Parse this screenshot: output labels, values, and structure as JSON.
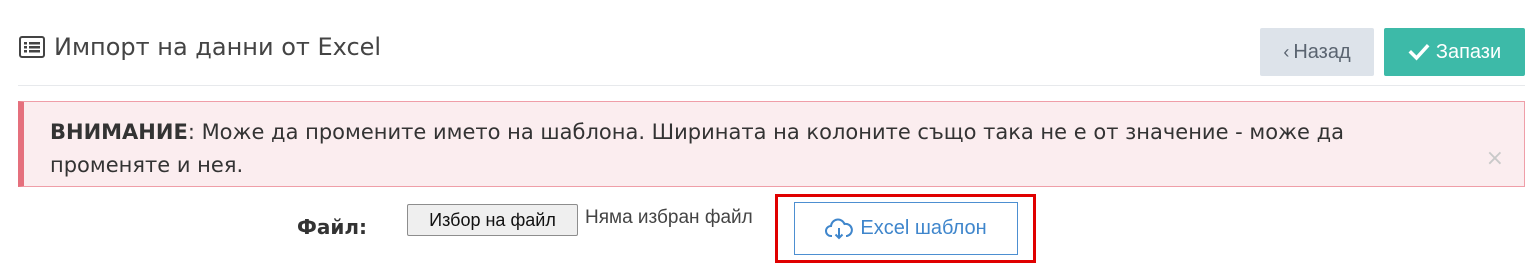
{
  "header": {
    "title": "Импорт на данни от Excel",
    "title_icon": "list-alt-icon"
  },
  "toolbar": {
    "back_label": "Назад",
    "back_icon": "chevron-left-icon",
    "save_label": "Запази",
    "save_icon": "check-icon"
  },
  "alert": {
    "strong": "ВНИМАНИЕ",
    "message": ": Може да промените името на шаблона. Ширината на колоните също така не е от значение - може да променяте и нея.",
    "close_label": "×"
  },
  "form": {
    "file_label": "Файл:",
    "file_button_label": "Избор на файл",
    "file_status": "Няма избран файл",
    "template_button_label": "Excel шаблон",
    "template_icon": "cloud-download-icon"
  },
  "colors": {
    "accent": "#3dbaa8",
    "alert_border": "#e5707d",
    "link": "#3f86cc",
    "highlight": "#e00000"
  }
}
